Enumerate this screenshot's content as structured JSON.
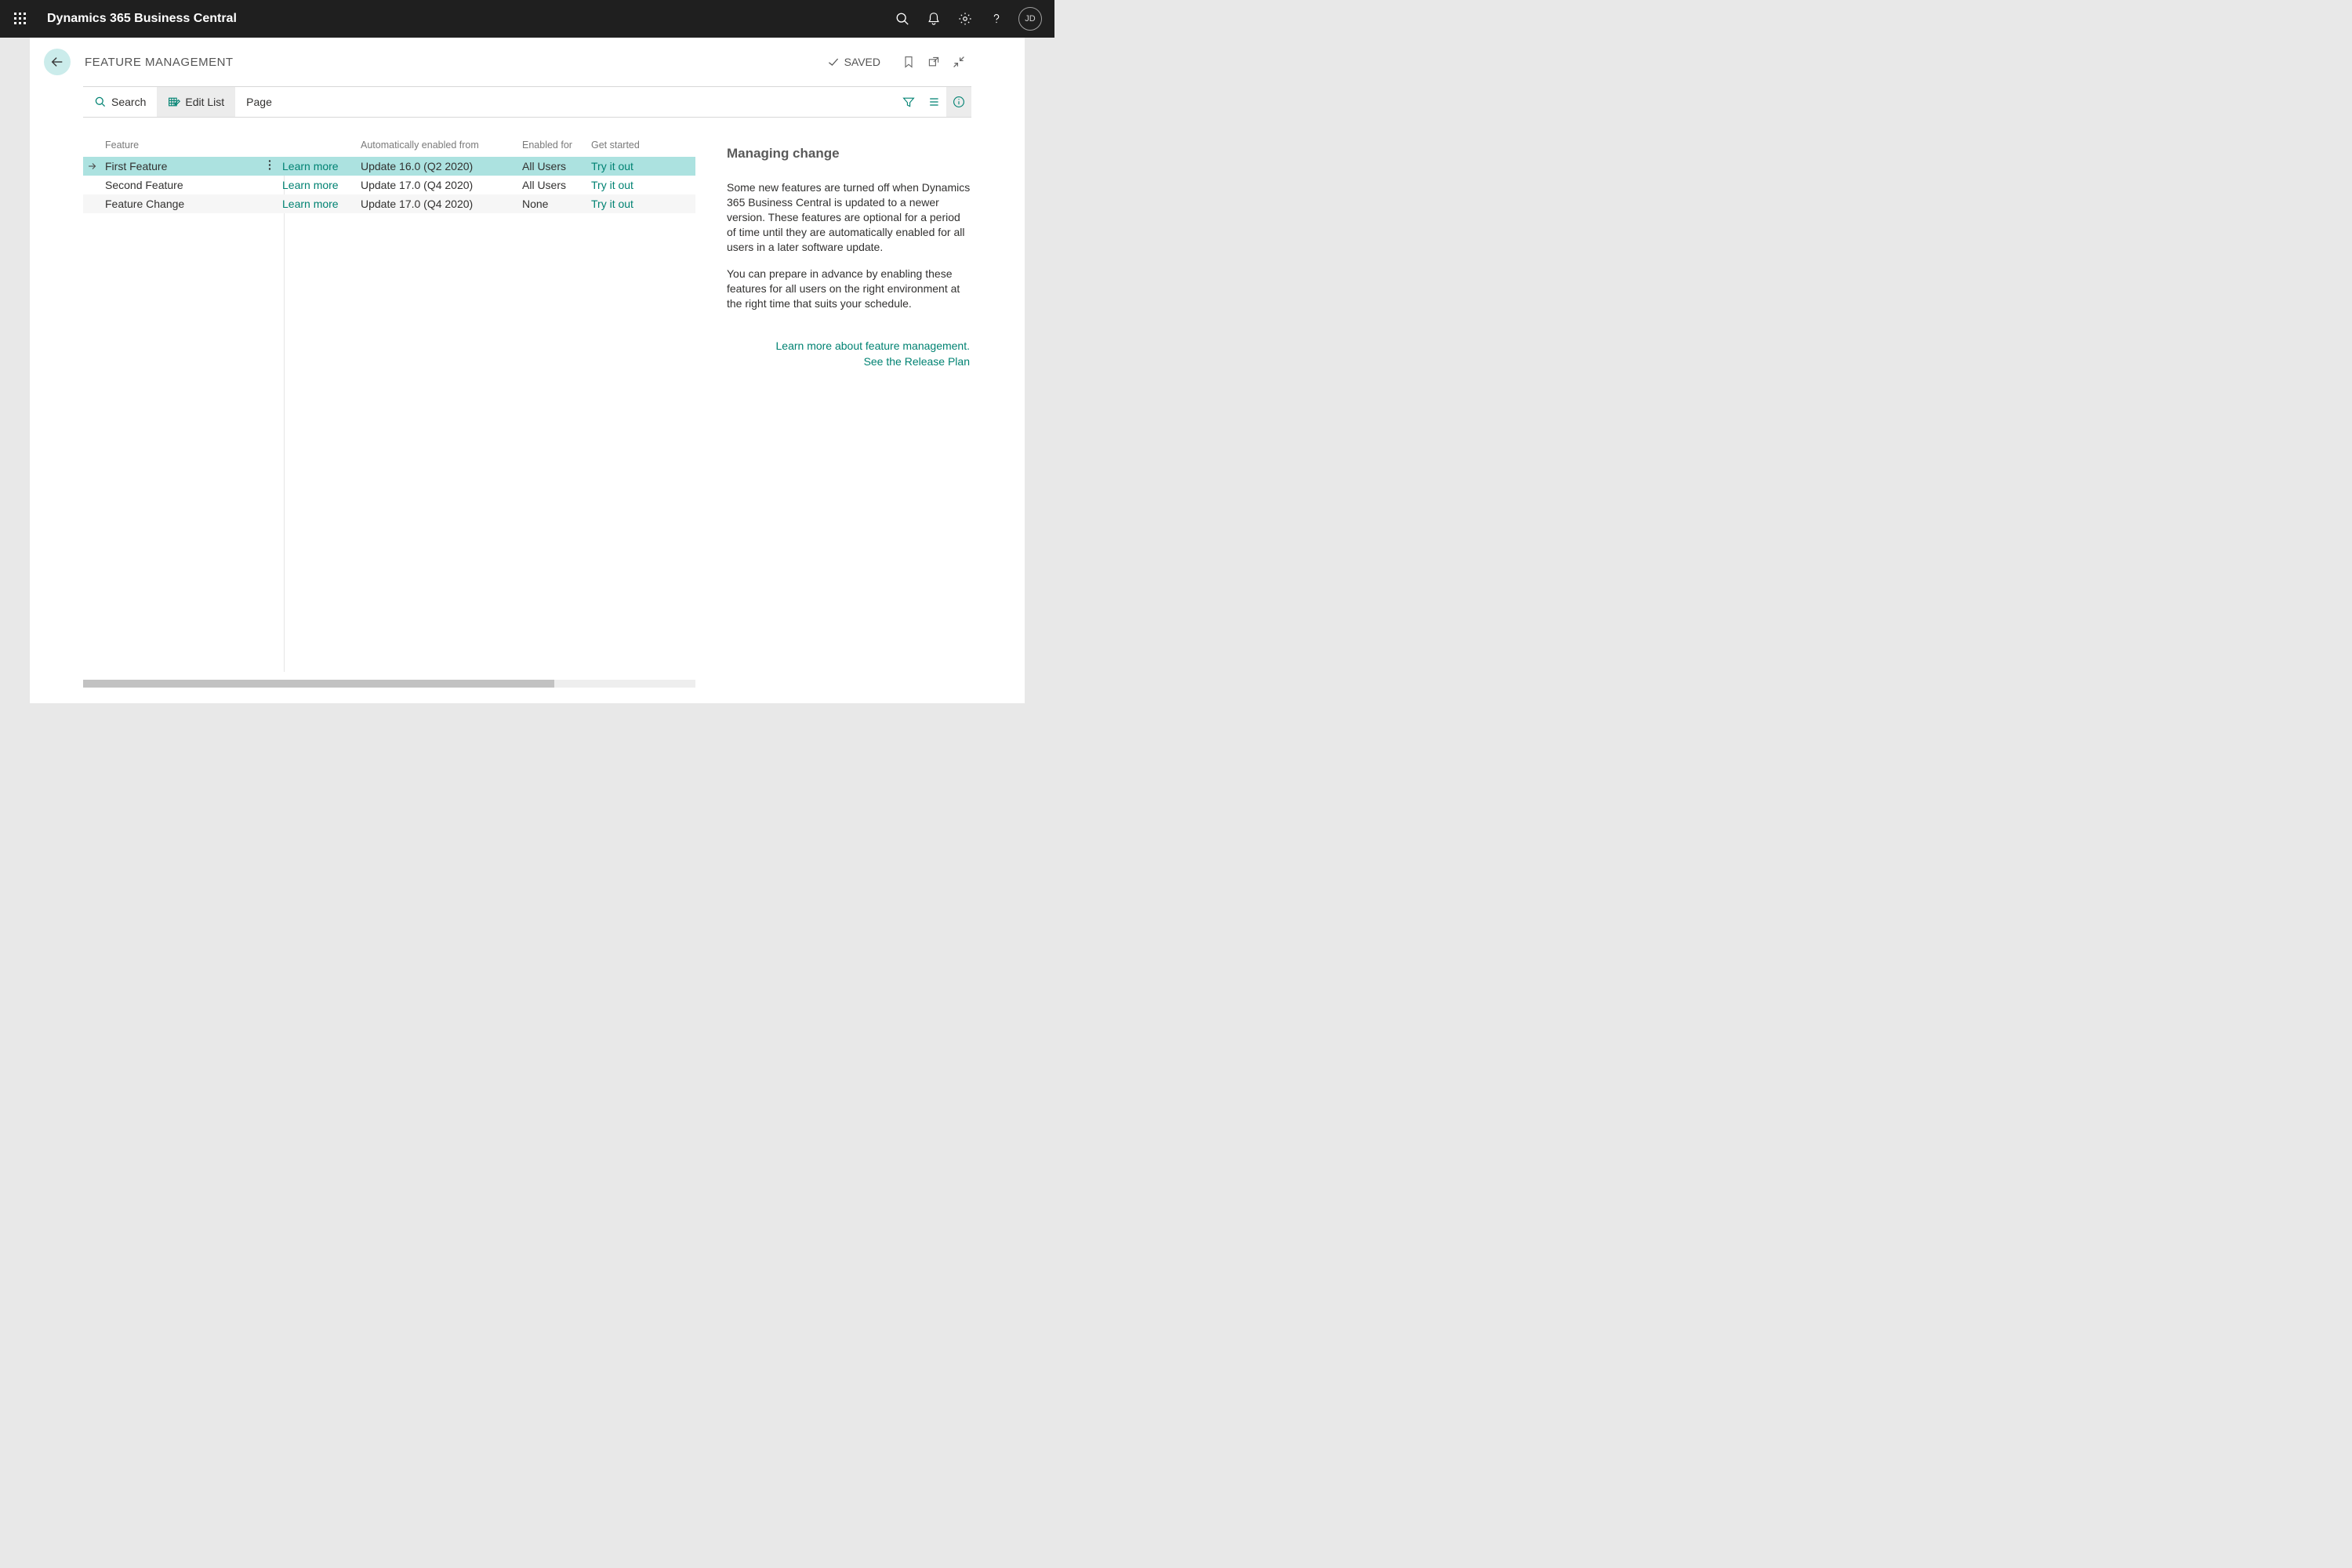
{
  "app": {
    "title": "Dynamics 365 Business Central",
    "avatar": "JD"
  },
  "page": {
    "title": "FEATURE MANAGEMENT",
    "saved": "SAVED"
  },
  "toolbar": {
    "search": "Search",
    "edit_list": "Edit List",
    "page": "Page"
  },
  "columns": {
    "feature": "Feature",
    "auto": "Automatically enabled from",
    "enabled_for": "Enabled for",
    "get_started": "Get started"
  },
  "rows": [
    {
      "feature": "First Feature",
      "learn": "Learn more",
      "auto": "Update 16.0 (Q2 2020)",
      "enabled_for": "All Users",
      "get_started": "Try it out"
    },
    {
      "feature": "Second Feature",
      "learn": "Learn more",
      "auto": "Update 17.0 (Q4 2020)",
      "enabled_for": "All Users",
      "get_started": "Try it out"
    },
    {
      "feature": "Feature Change",
      "learn": "Learn more",
      "auto": "Update 17.0 (Q4 2020)",
      "enabled_for": "None",
      "get_started": "Try it out"
    }
  ],
  "factbox": {
    "title": "Managing change",
    "p1": "Some new features are turned off when Dynamics 365 Business Central is updated to a newer version. These features are optional for a period of time until they are automatically enabled for all users in a later software update.",
    "p2": "You can prepare in advance by enabling these features for all users on the right environment at the right time that suits your schedule.",
    "link1": "Learn more about feature management.",
    "link2": "See the Release Plan"
  }
}
